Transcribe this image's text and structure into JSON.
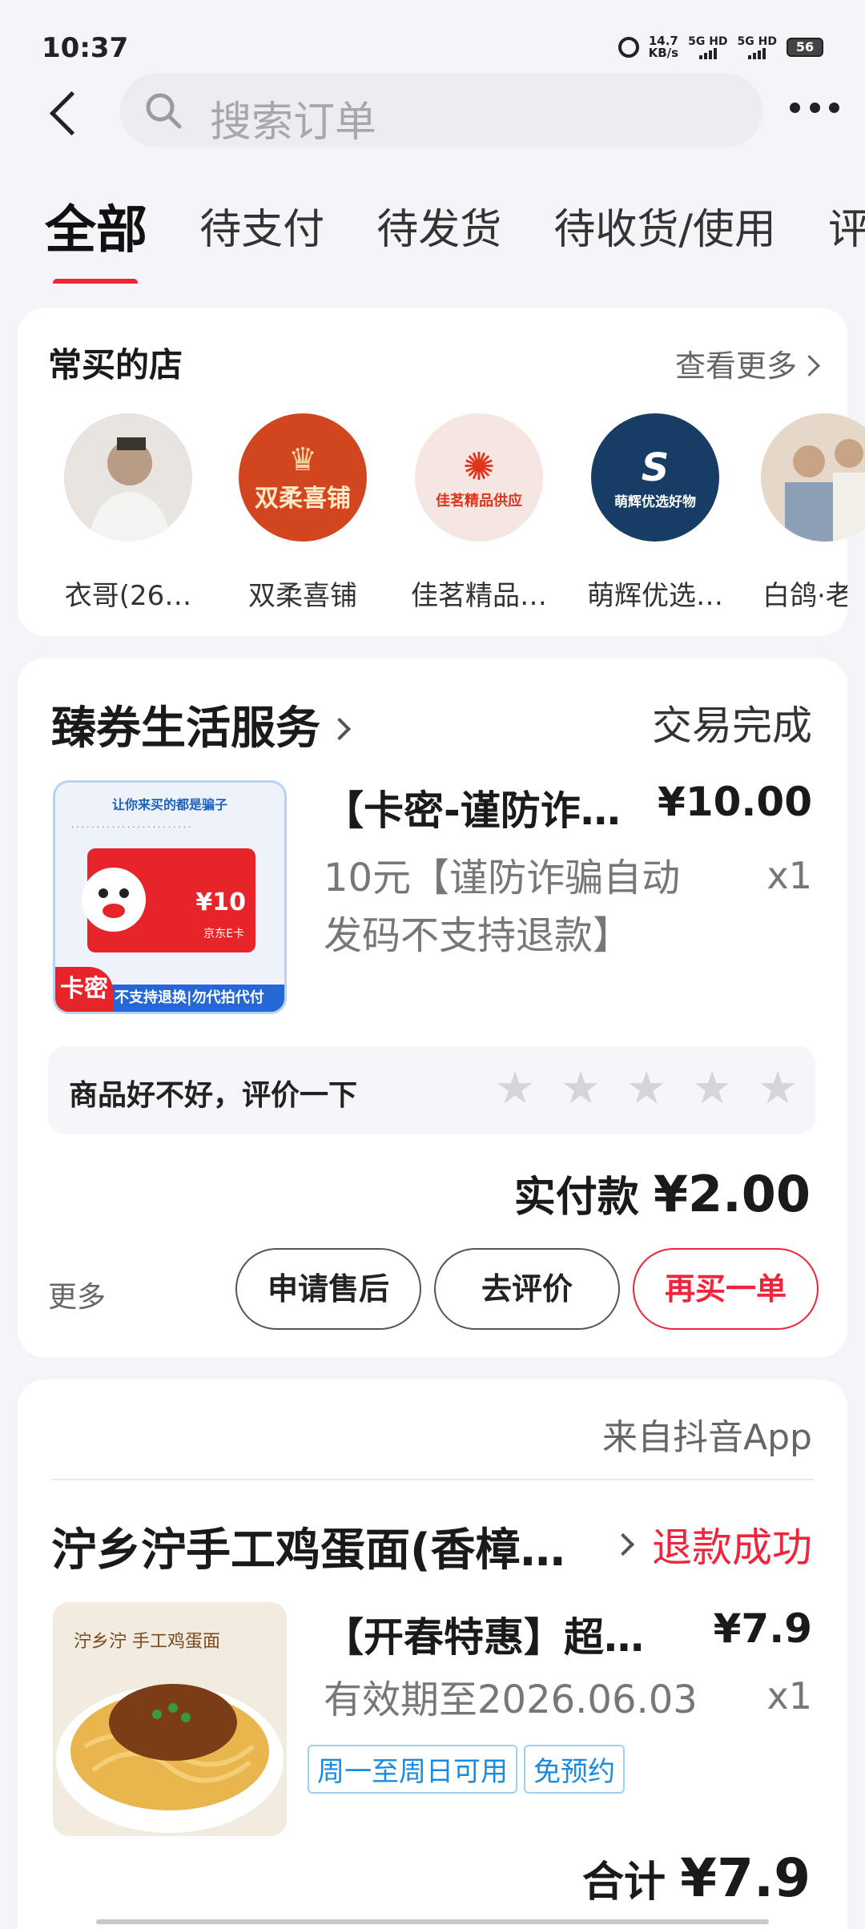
{
  "status_bar": {
    "time": "10:37",
    "speed": "14.7",
    "speed_unit": "KB/s",
    "net1": "5G HD",
    "net2": "5G HD",
    "battery": "56"
  },
  "header": {
    "search_placeholder": "搜索订单"
  },
  "tabs": [
    "全部",
    "待支付",
    "待发货",
    "待收货/使用",
    "评"
  ],
  "frequent_shops": {
    "title": "常买的店",
    "more": "查看更多",
    "shops": [
      {
        "name": "衣哥(26…",
        "logo_text": ""
      },
      {
        "name": "双柔喜铺",
        "logo_text": "双柔喜铺"
      },
      {
        "name": "佳茗精品…",
        "logo_text": "佳茗精品供应"
      },
      {
        "name": "萌辉优选…",
        "logo_text": "萌辉优选好物"
      },
      {
        "name": "白鸽·老",
        "logo_text": ""
      }
    ]
  },
  "order1": {
    "store": "臻券生活服务",
    "status": "交易完成",
    "product_title": "【卡密-谨防诈…",
    "price": "¥10.00",
    "desc": "10元【谨防诈骗自动发码不支持退款】",
    "qty": "x1",
    "thumb": {
      "top_text": "让你来买的都是骗子",
      "card_value": "¥10",
      "card_label": "京东E卡",
      "badge": "卡密",
      "bottom_text": "不支持退换|勿代拍代付"
    },
    "rate_prompt": "商品好不好，评价一下",
    "paid_label": "实付款",
    "paid_amount": "¥2.00",
    "more": "更多",
    "buttons": [
      "申请售后",
      "去评价",
      "再买一单"
    ]
  },
  "order2": {
    "source": "来自抖音App",
    "store": "泞乡泞手工鸡蛋面(香樟…",
    "status": "退款成功",
    "product_title": "【开春特惠】超…",
    "price": "¥7.9",
    "desc": "有效期至2026.06.03",
    "qty": "x1",
    "tags": [
      "周一至周日可用",
      "免预约"
    ],
    "total_label": "合计",
    "total_amount": "¥7.9"
  },
  "colors": {
    "accent": "#f0243a",
    "tag_blue": "#1a8be0"
  }
}
